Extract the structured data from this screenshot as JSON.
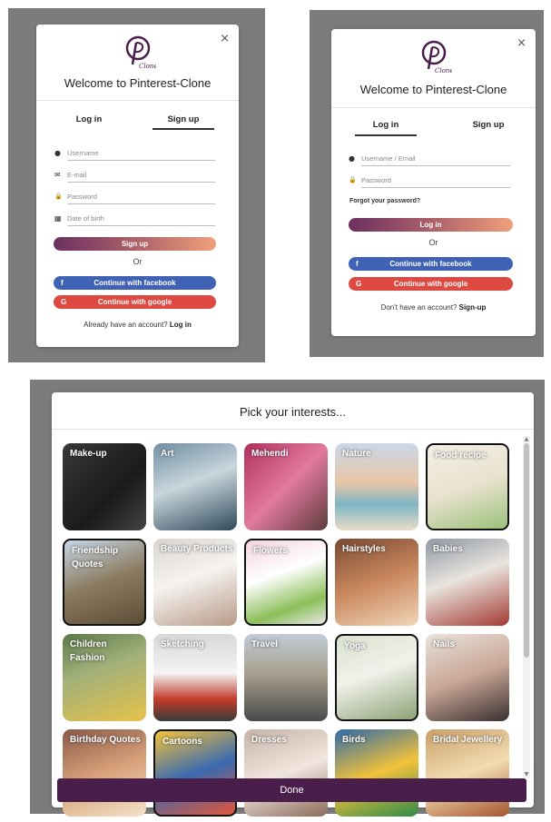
{
  "brand": {
    "logo_text": "Clone",
    "colors": {
      "primary": "#4a1e4b",
      "facebook": "#3f62b5",
      "google": "#de4a42",
      "gradient_start": "#6b3060",
      "gradient_end": "#f0a07a"
    }
  },
  "signup_modal": {
    "close": "×",
    "welcome": "Welcome to Pinterest-Clone",
    "tabs": [
      "Log in",
      "Sign up"
    ],
    "active_tab": "Sign up",
    "fields": [
      {
        "icon": "user-icon",
        "glyph": "●",
        "placeholder": "Username"
      },
      {
        "icon": "mail-icon",
        "glyph": "✉",
        "placeholder": "E-mail"
      },
      {
        "icon": "lock-icon",
        "glyph": "🔒",
        "placeholder": "Password"
      },
      {
        "icon": "calendar-icon",
        "glyph": "▦",
        "placeholder": "Date of birth"
      }
    ],
    "submit": "Sign up",
    "or": "Or",
    "facebook": "Continue with facebook",
    "facebook_icon": "f",
    "google": "Continue with google",
    "google_icon": "G",
    "footer_text": "Already have an account?",
    "footer_link": "Log in"
  },
  "login_modal": {
    "close": "×",
    "welcome": "Welcome to Pinterest-Clone",
    "tabs": [
      "Log in",
      "Sign up"
    ],
    "active_tab": "Log in",
    "fields": [
      {
        "icon": "user-icon",
        "glyph": "●",
        "placeholder": "Username / Email"
      },
      {
        "icon": "lock-icon",
        "glyph": "🔒",
        "placeholder": "Password"
      }
    ],
    "forgot": "Forgot your password?",
    "submit": "Log in",
    "or": "Or",
    "facebook": "Continue with facebook",
    "facebook_icon": "f",
    "google": "Continue with google",
    "google_icon": "G",
    "footer_text": "Don't have an account?",
    "footer_link": "Sign-up"
  },
  "interests_modal": {
    "title": "Pick your interests...",
    "done": "Done",
    "tiles": [
      {
        "label": "Make-up",
        "selected": false,
        "bg": "linear-gradient(135deg,#3a3a3a,#1a1a1a 60%,#444)"
      },
      {
        "label": "Art",
        "selected": false,
        "bg": "linear-gradient(160deg,#6f8fa3,#c9d6dc 45%,#2e4a5a)"
      },
      {
        "label": "Mehendi",
        "selected": false,
        "bg": "linear-gradient(135deg,#b0305c,#e27aa0 50%,#5b3a3a)"
      },
      {
        "label": "Nature",
        "selected": false,
        "bg": "linear-gradient(180deg,#c9d8e8,#e8c6a6 45%,#7fb6c6 70%,#e9dcc6)"
      },
      {
        "label": "Food recipe",
        "selected": true,
        "bg": "linear-gradient(160deg,#f3efe6,#e9e2cf 50%,#9bc17a)"
      },
      {
        "label": "Friendship Quotes",
        "selected": true,
        "bg": "linear-gradient(160deg,#c7d7e8,#8a7a5e 50%,#5e4d36)"
      },
      {
        "label": "Beauty Products",
        "selected": false,
        "bg": "linear-gradient(160deg,#d9d4cf,#f6f3f0 45%,#b89a88)"
      },
      {
        "label": "Flowers",
        "selected": true,
        "bg": "linear-gradient(160deg,#f3d3de,#ffffff 40%,#8cbf5a 75%,#e7e7e7)"
      },
      {
        "label": "Hairstyles",
        "selected": false,
        "bg": "linear-gradient(160deg,#7b4a33,#c9885e 50%,#f1d5b8)"
      },
      {
        "label": "Babies",
        "selected": false,
        "bg": "linear-gradient(160deg,#8f98a4,#e9e4de 45%,#a23a32)"
      },
      {
        "label": "Children Fashion",
        "selected": false,
        "bg": "linear-gradient(160deg,#5b7a4a,#a1b07a 40%,#e6c24a)"
      },
      {
        "label": "Sketching",
        "selected": false,
        "bg": "linear-gradient(180deg,#d8d8d8,#f4f4f4 45%,#c23a2a 75%,#3a3a3a)"
      },
      {
        "label": "Travel",
        "selected": false,
        "bg": "linear-gradient(180deg,#c0ccd8,#a9a08e 45%,#4a4a4a)"
      },
      {
        "label": "Yoga",
        "selected": true,
        "bg": "linear-gradient(160deg,#d9e2d0,#f1f1ea 45%,#8da377)"
      },
      {
        "label": "Nails",
        "selected": false,
        "bg": "linear-gradient(160deg,#e9e3dc,#c9a696 50%,#3a3030)"
      },
      {
        "label": "Birthday Quotes",
        "selected": false,
        "bg": "linear-gradient(160deg,#8a5a4a,#d9a27a 50%,#f3e3c8)"
      },
      {
        "label": "Cartoons",
        "selected": true,
        "bg": "linear-gradient(160deg,#f6c33a,#3a6ab0 50%,#e2553a)"
      },
      {
        "label": "Dresses",
        "selected": false,
        "bg": "linear-gradient(160deg,#c6b3a6,#f1e6de 50%,#8a6a5a)"
      },
      {
        "label": "Birds",
        "selected": false,
        "bg": "linear-gradient(160deg,#2e6aa8,#f2c23a 50%,#2e8a4a)"
      },
      {
        "label": "Bridal Jewellery",
        "selected": false,
        "bg": "linear-gradient(160deg,#c9a06a,#f3dcb0 50%,#a5552e)"
      }
    ]
  }
}
